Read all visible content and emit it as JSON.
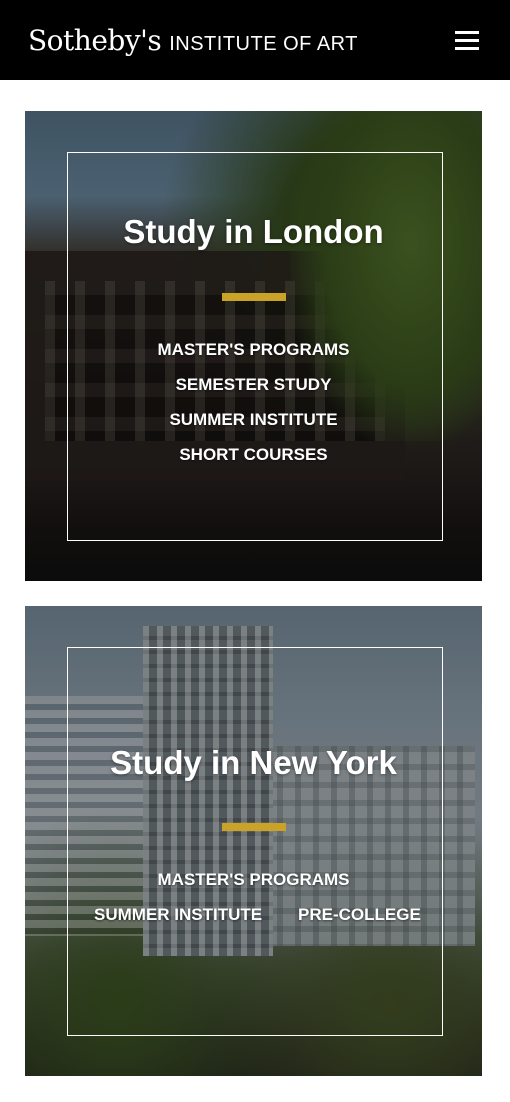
{
  "header": {
    "logo_script": "Sotheby's",
    "logo_sub": "INSTITUTE OF ART",
    "menu_icon": "hamburger-menu-icon"
  },
  "colors": {
    "header_bg": "#000000",
    "accent": "#c9a227",
    "text": "#ffffff"
  },
  "cards": [
    {
      "title": "Study in London",
      "links": [
        "MASTER'S PROGRAMS",
        "SEMESTER STUDY",
        "SUMMER INSTITUTE",
        "SHORT COURSES"
      ]
    },
    {
      "title": "Study in New York",
      "links": [
        "MASTER'S PROGRAMS",
        "SUMMER INSTITUTE",
        "PRE-COLLEGE"
      ]
    }
  ]
}
